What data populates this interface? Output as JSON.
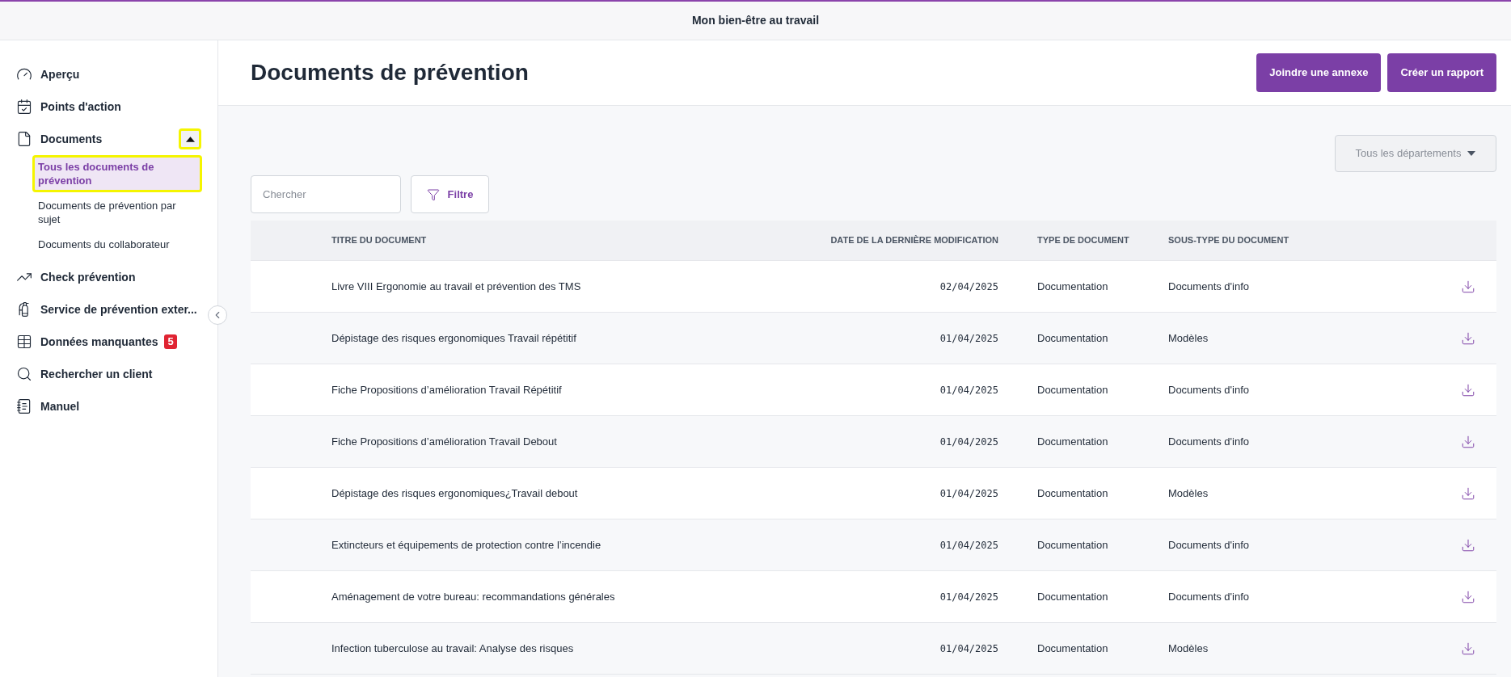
{
  "app_bar": {
    "title": "Mon bien-être au travail"
  },
  "sidebar": {
    "items": [
      {
        "label": "Aperçu",
        "selected": false
      },
      {
        "label": "Points d'action",
        "selected": false
      },
      {
        "label": "Documents",
        "selected": false,
        "expanded": true,
        "toggle_highlighted": true,
        "children": [
          {
            "label": "Tous les documents de prévention",
            "selected": true,
            "highlighted": true
          },
          {
            "label": "Documents de prévention par sujet",
            "selected": false,
            "highlighted": false
          },
          {
            "label": "Documents du collaborateur",
            "selected": false,
            "highlighted": false
          }
        ]
      },
      {
        "label": "Check prévention",
        "selected": false
      },
      {
        "label": "Service de prévention exter...",
        "selected": false
      },
      {
        "label": "Données manquantes",
        "selected": false,
        "badge": "5"
      },
      {
        "label": "Rechercher un client",
        "selected": false
      },
      {
        "label": "Manuel",
        "selected": false
      }
    ]
  },
  "page": {
    "title": "Documents de prévention",
    "actions": [
      "Joindre une annexe",
      "Créer un rapport"
    ]
  },
  "department_select": {
    "value": "Tous les départements",
    "disabled": true
  },
  "search": {
    "placeholder": "Chercher"
  },
  "filter_button": "Filtre",
  "table": {
    "columns": [
      "TITRE DU DOCUMENT",
      "DATE DE LA DERNIÈRE MODIFICATION",
      "TYPE DE DOCUMENT",
      "SOUS-TYPE DU DOCUMENT"
    ],
    "rows": [
      {
        "title": "Livre VIII Ergonomie au travail et prévention des TMS",
        "date": "02/04/2025",
        "type": "Documentation",
        "subtype": "Documents d'info"
      },
      {
        "title": "Dépistage des risques ergonomiques Travail répétitif",
        "date": "01/04/2025",
        "type": "Documentation",
        "subtype": "Modèles"
      },
      {
        "title": "Fiche Propositions d’amélioration Travail Répétitif",
        "date": "01/04/2025",
        "type": "Documentation",
        "subtype": "Documents d'info"
      },
      {
        "title": "Fiche Propositions d’amélioration Travail Debout",
        "date": "01/04/2025",
        "type": "Documentation",
        "subtype": "Documents d'info"
      },
      {
        "title": "Dépistage des risques ergonomiques¿Travail debout",
        "date": "01/04/2025",
        "type": "Documentation",
        "subtype": "Modèles"
      },
      {
        "title": "Extincteurs et équipements de protection contre l’incendie",
        "date": "01/04/2025",
        "type": "Documentation",
        "subtype": "Documents d'info"
      },
      {
        "title": "Aménagement de votre bureau: recommandations générales",
        "date": "01/04/2025",
        "type": "Documentation",
        "subtype": "Documents d'info"
      },
      {
        "title": "Infection tuberculose au travail: Analyse des risques",
        "date": "01/04/2025",
        "type": "Documentation",
        "subtype": "Modèles"
      }
    ]
  }
}
